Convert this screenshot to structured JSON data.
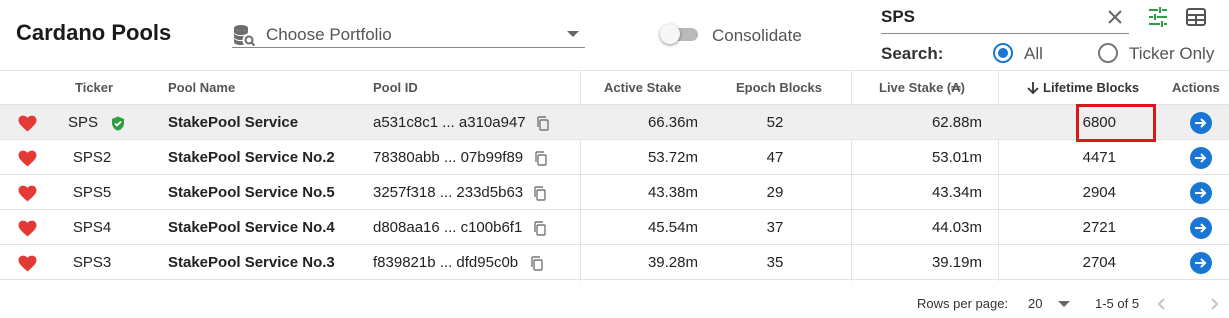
{
  "app": {
    "title": "Cardano Pools"
  },
  "toolbar": {
    "portfolio_label": "Choose Portfolio",
    "consolidate_label": "Consolidate",
    "search_value": "SPS",
    "search_label": "Search:",
    "search_options": [
      "All",
      "Ticker Only"
    ],
    "search_selected": "All"
  },
  "table": {
    "headers": [
      "Ticker",
      "Pool Name",
      "Pool ID",
      "Active Stake",
      "Epoch Blocks",
      "Live Stake (₳)",
      "Lifetime Blocks",
      "Actions"
    ],
    "sort": {
      "column": "Lifetime Blocks",
      "direction": "desc"
    },
    "rows": [
      {
        "ticker": "SPS",
        "verified": true,
        "name": "StakePool Service",
        "pool_id": "a531c8c1 ... a310a947",
        "active_stake": "66.36m",
        "epoch_blocks": "52",
        "live_stake": "62.88m",
        "lifetime_blocks": "6800"
      },
      {
        "ticker": "SPS2",
        "verified": false,
        "name": "StakePool Service No.2",
        "pool_id": "78380abb ... 07b99f89",
        "active_stake": "53.72m",
        "epoch_blocks": "47",
        "live_stake": "53.01m",
        "lifetime_blocks": "4471"
      },
      {
        "ticker": "SPS5",
        "verified": false,
        "name": "StakePool Service No.5",
        "pool_id": "3257f318 ... 233d5b63",
        "active_stake": "43.38m",
        "epoch_blocks": "29",
        "live_stake": "43.34m",
        "lifetime_blocks": "2904"
      },
      {
        "ticker": "SPS4",
        "verified": false,
        "name": "StakePool Service No.4",
        "pool_id": "d808aa16 ... c100b6f1",
        "active_stake": "45.54m",
        "epoch_blocks": "37",
        "live_stake": "44.03m",
        "lifetime_blocks": "2721"
      },
      {
        "ticker": "SPS3",
        "verified": false,
        "name": "StakePool Service No.3",
        "pool_id": "f839821b ... dfd95c0b",
        "active_stake": "39.28m",
        "epoch_blocks": "35",
        "live_stake": "39.19m",
        "lifetime_blocks": "2704"
      }
    ]
  },
  "pagination": {
    "rows_per_page_label": "Rows per page:",
    "rows_per_page": "20",
    "range": "1-5 of 5"
  },
  "colors": {
    "accent": "#1976d2",
    "heart": "#e53935",
    "verified": "#2e9e44",
    "highlight": "#d61a1a",
    "tune": "#2e9e44"
  },
  "icons": [
    "database-search-icon",
    "chevron-down-icon",
    "close-icon",
    "tune-icon",
    "table-grid-icon",
    "heart-icon",
    "verified-icon",
    "copy-icon",
    "arrow-right-icon",
    "arrow-down-icon",
    "chevron-left-icon",
    "chevron-right-icon"
  ]
}
